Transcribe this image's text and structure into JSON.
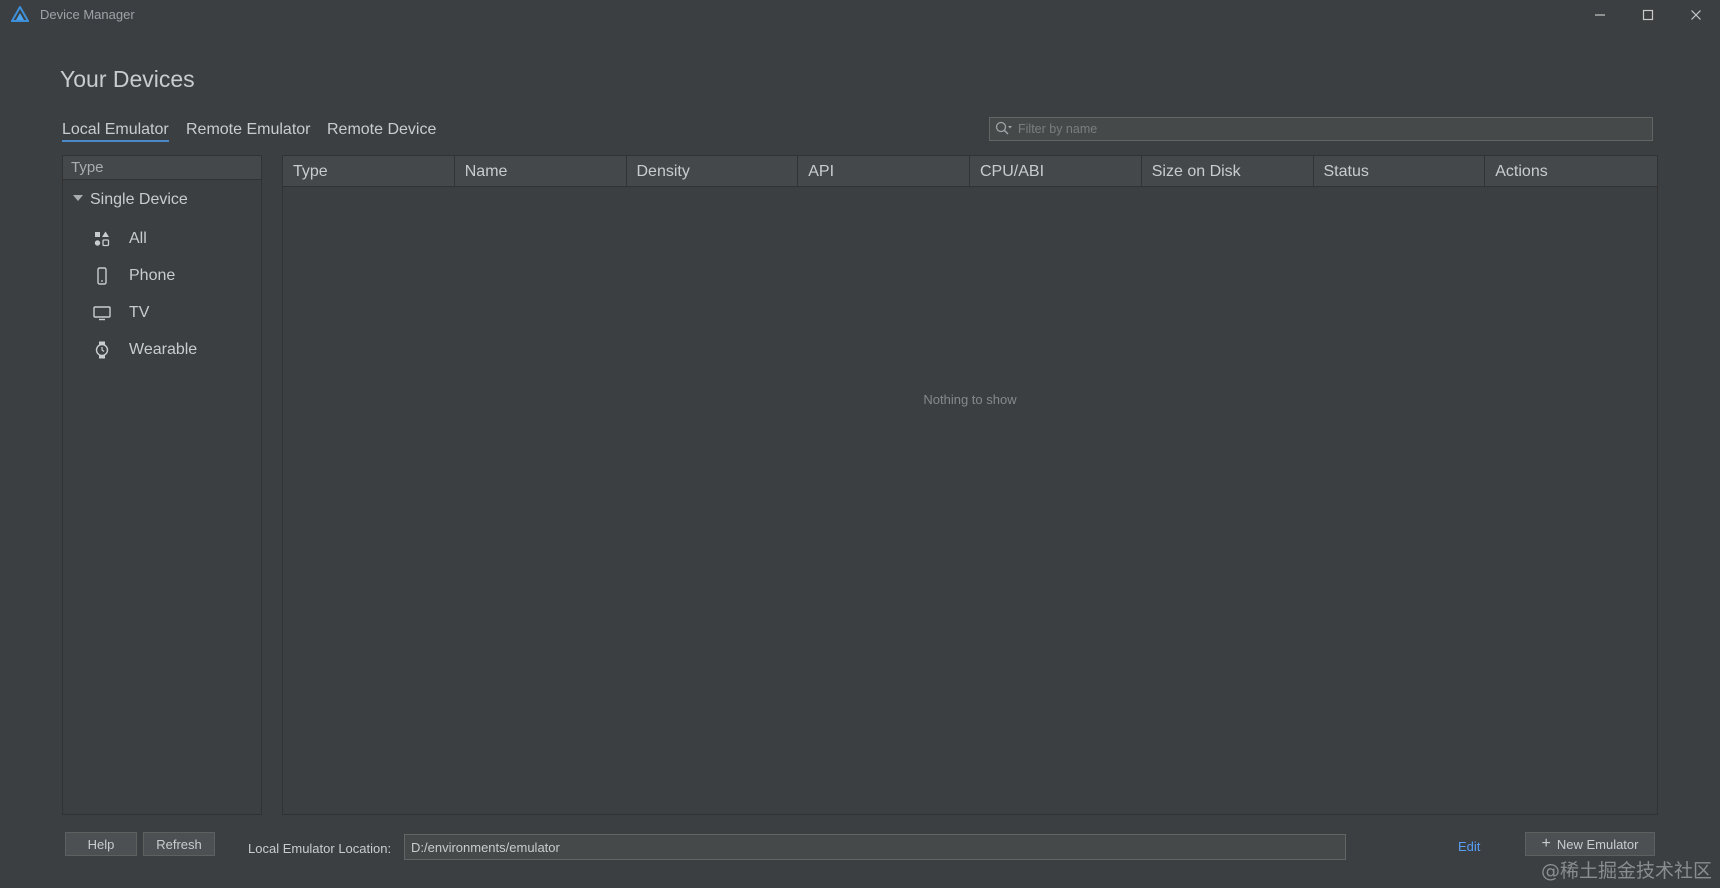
{
  "window": {
    "title": "Device Manager",
    "minimize_glyph": "—",
    "maximize_glyph": "☐",
    "close_glyph": "✕"
  },
  "page": {
    "title": "Your Devices"
  },
  "tabs": [
    {
      "label": "Local Emulator",
      "active": true
    },
    {
      "label": "Remote Emulator",
      "active": false
    },
    {
      "label": "Remote Device",
      "active": false
    }
  ],
  "search": {
    "placeholder": "Filter by name",
    "value": ""
  },
  "sidebar": {
    "header": "Type",
    "group": {
      "label": "Single Device",
      "expanded": true
    },
    "items": [
      {
        "label": "All",
        "icon": "grid-shapes-icon"
      },
      {
        "label": "Phone",
        "icon": "phone-icon"
      },
      {
        "label": "TV",
        "icon": "tv-icon"
      },
      {
        "label": "Wearable",
        "icon": "watch-icon"
      }
    ]
  },
  "table": {
    "columns": [
      "Type",
      "Name",
      "Density",
      "API",
      "CPU/ABI",
      "Size on Disk",
      "Status",
      "Actions"
    ],
    "rows": [],
    "empty_text": "Nothing to show"
  },
  "footer": {
    "help_label": "Help",
    "refresh_label": "Refresh",
    "location_label": "Local Emulator Location:",
    "location_value": "D:/environments/emulator",
    "edit_label": "Edit",
    "new_emulator_label": "New Emulator"
  },
  "watermark": "@稀土掘金技术社区",
  "colors": {
    "background": "#3c3f41",
    "header": "#45484a",
    "accent": "#4a88c7",
    "link": "#589df6"
  }
}
